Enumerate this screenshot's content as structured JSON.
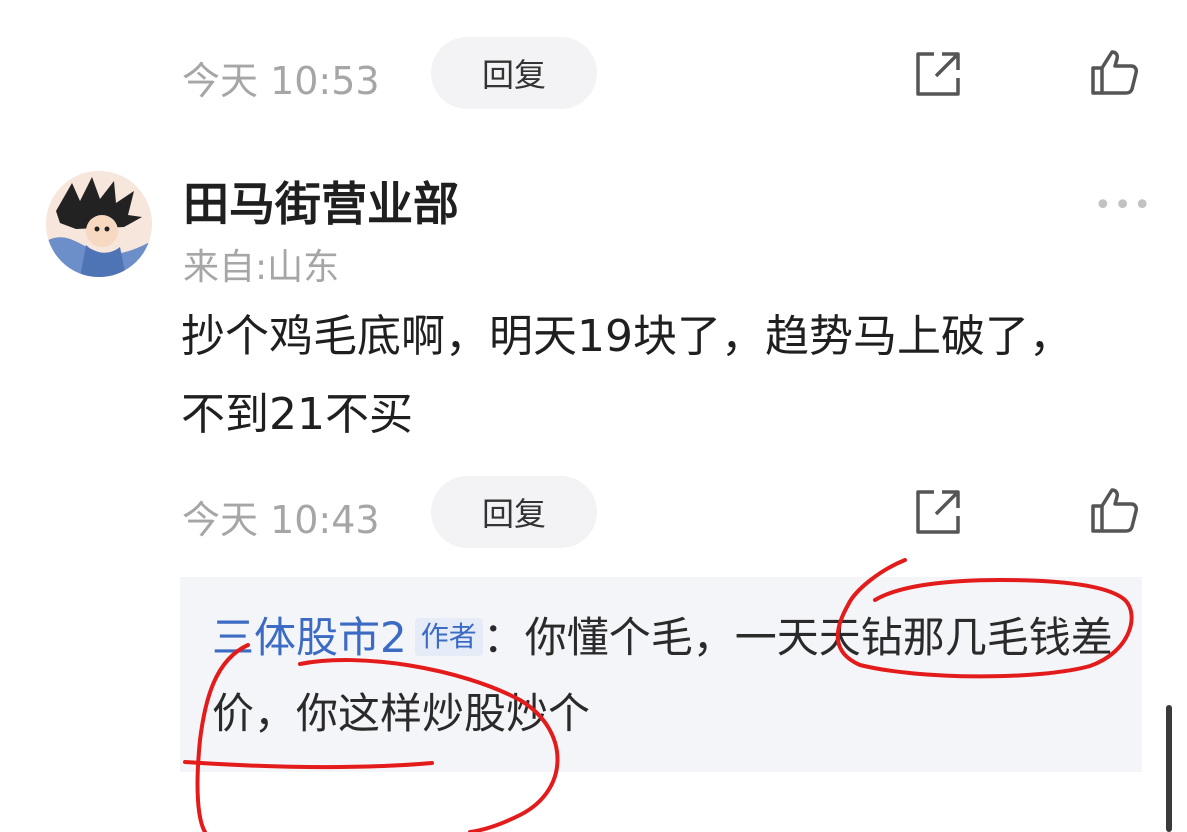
{
  "previous_comment": {
    "time": "今天 10:53",
    "reply_label": "回复"
  },
  "comment": {
    "username": "田马街营业部",
    "location": "来自:山东",
    "text": "抄个鸡毛底啊，明天19块了，趋势马上破了，不到21不买",
    "time": "今天 10:43",
    "reply_label": "回复",
    "more_label": "•••"
  },
  "reply": {
    "author": "三体股市2",
    "badge": "作者",
    "separator": "：",
    "text": "你懂个毛，一天天钻那几毛钱差价，你这样炒股炒个"
  },
  "colors": {
    "annotation": "#e31b1b",
    "link": "#3c6bc4"
  },
  "icons": [
    "share-icon",
    "like-icon",
    "more-icon",
    "avatar"
  ]
}
